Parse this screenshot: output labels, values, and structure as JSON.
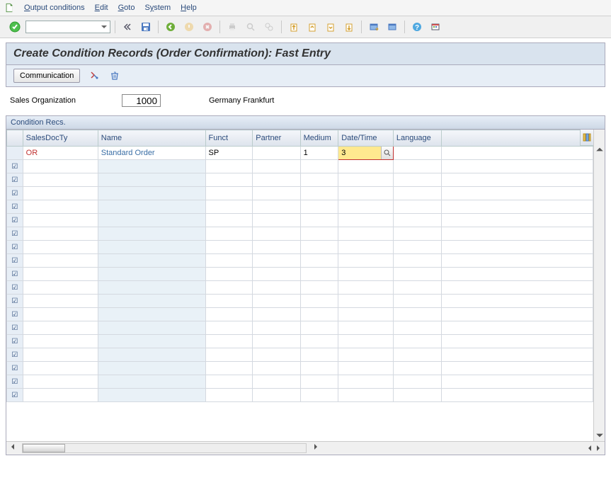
{
  "menu": {
    "output_conditions": "Output conditions",
    "edit": "Edit",
    "goto": "Goto",
    "system": "System",
    "help": "Help"
  },
  "title": "Create Condition Records (Order Confirmation): Fast Entry",
  "appbar": {
    "communication": "Communication"
  },
  "form": {
    "sales_org_label": "Sales Organization",
    "sales_org_value": "1000",
    "sales_org_text": "Germany Frankfurt"
  },
  "grid": {
    "title": "Condition Recs.",
    "headers": {
      "salesdocty": "SalesDocTy",
      "name": "Name",
      "funct": "Funct",
      "partner": "Partner",
      "medium": "Medium",
      "datetime": "Date/Time",
      "language": "Language"
    },
    "rows": [
      {
        "salesdocty": "OR",
        "name": "Standard Order",
        "funct": "SP",
        "partner": "",
        "medium": "1",
        "datetime": "3",
        "language": ""
      }
    ]
  },
  "icons": {
    "check": "accept",
    "save": "save",
    "back": "back"
  }
}
